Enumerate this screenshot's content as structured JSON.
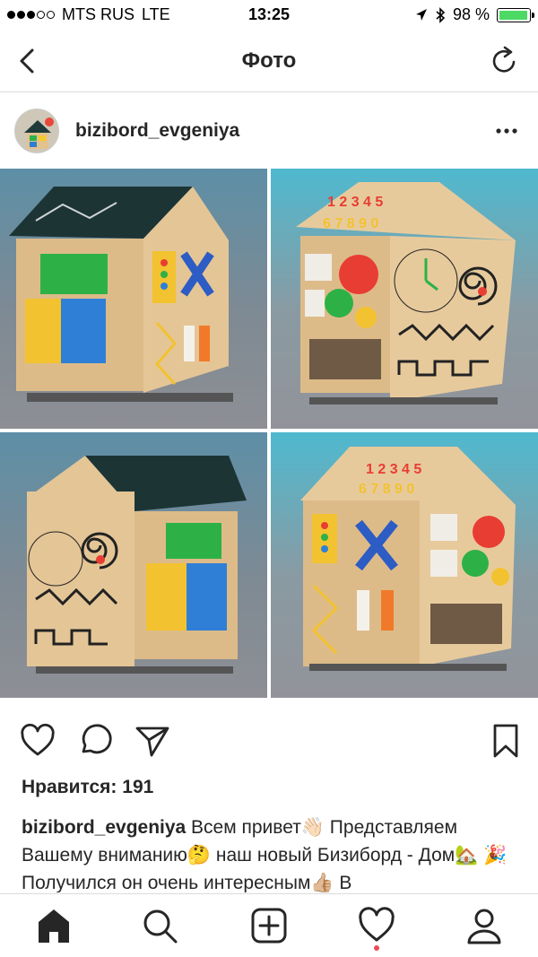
{
  "status_bar": {
    "carrier": "MTS RUS",
    "network": "LTE",
    "time": "13:25",
    "battery_text": "98 %",
    "battery_level": 0.98,
    "signal_bars": 3,
    "signal_total": 5,
    "battery_color": "#4cd964"
  },
  "nav": {
    "title": "Фото",
    "back_icon": "chevron-left-icon",
    "refresh_icon": "refresh-icon"
  },
  "post": {
    "username": "bizibord_evgeniya",
    "more_icon": "more-horizontal-icon",
    "photo_description_icons": [
      "busy-house-toy"
    ],
    "likes": "Нравится: 191",
    "caption_user": "bizibord_evgeniya",
    "caption_text": " Всем привет👋🏻 Представляем Вашему вниманию🤔  наш новый Бизиборд - Дом🏡 🎉  Получился он очень интересным👍🏼 В"
  },
  "tabs": [
    "home-icon",
    "search-icon",
    "add-icon",
    "activity-icon",
    "profile-icon"
  ],
  "colors": {
    "text": "#262626",
    "divider": "#dbdbdb",
    "notification": "#ed4956"
  }
}
